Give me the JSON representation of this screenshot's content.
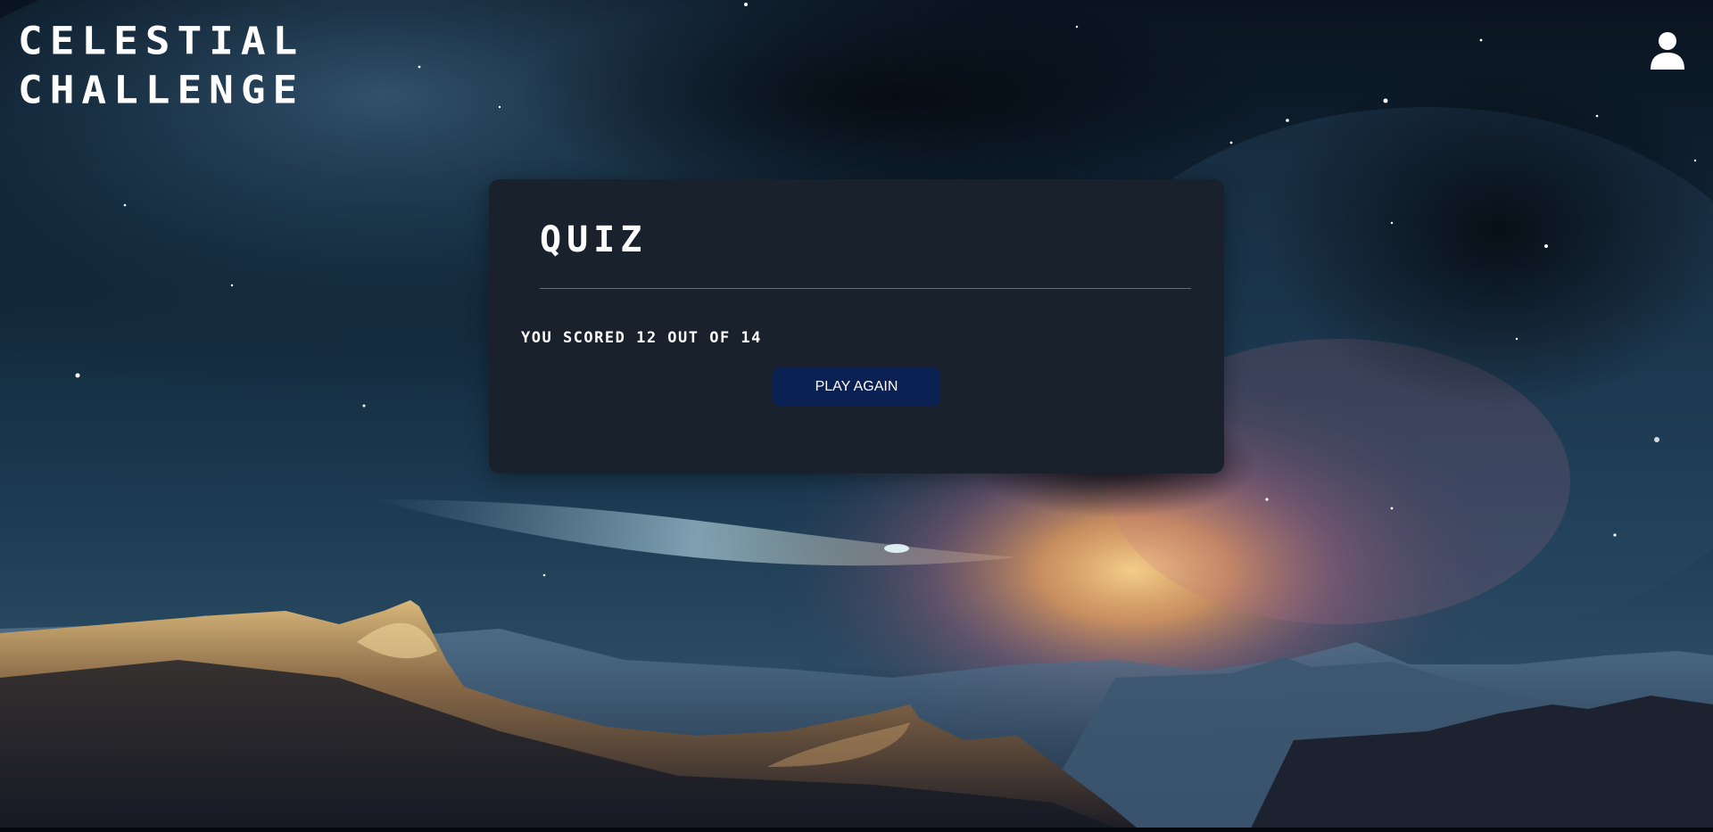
{
  "header": {
    "title_line1": "CELESTIAL",
    "title_line2": "CHALLENGE",
    "user_icon": "user-icon"
  },
  "quiz": {
    "heading": "QUIZ",
    "score_text": "YOU SCORED 12 OUT OF 14",
    "play_again_label": "PLAY AGAIN"
  },
  "colors": {
    "card_background": "#19212d",
    "divider": "#1f9e3a",
    "button_background": "#0b2153",
    "text": "#ffffff"
  }
}
